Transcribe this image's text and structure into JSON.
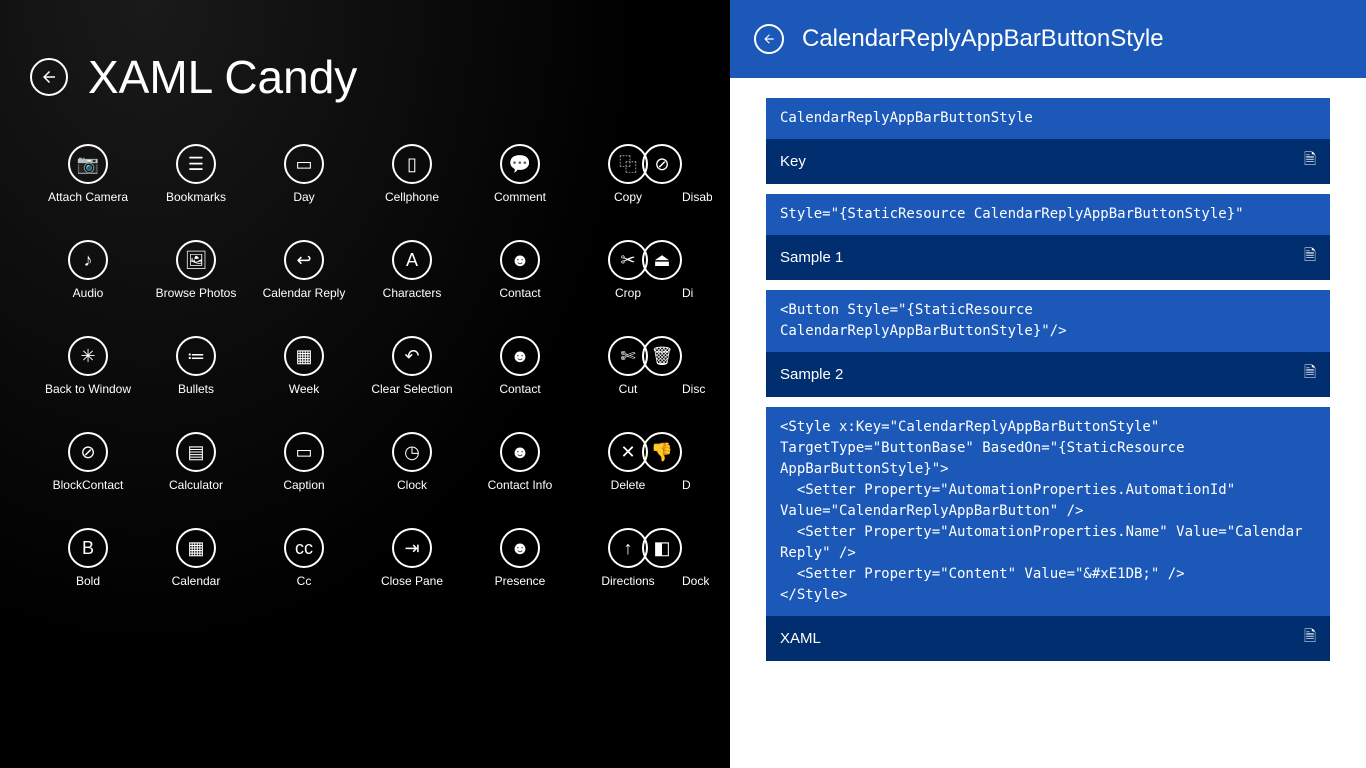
{
  "app_title": "XAML Candy",
  "colors": {
    "accent": "#1b58b8",
    "dark_accent": "#002e6e"
  },
  "icons": [
    {
      "label": "Attach Camera",
      "glyph": "📷"
    },
    {
      "label": "Bookmarks",
      "glyph": "☰"
    },
    {
      "label": "Day",
      "glyph": "▭"
    },
    {
      "label": "Cellphone",
      "glyph": "▯"
    },
    {
      "label": "Comment",
      "glyph": "💬"
    },
    {
      "label": "Copy",
      "glyph": "⿻"
    },
    {
      "label": "DisableUpdates",
      "glyph": "⊘",
      "cut": "Disabl"
    },
    {
      "label": "Audio",
      "glyph": "♪"
    },
    {
      "label": "Browse Photos",
      "glyph": "🖼"
    },
    {
      "label": "Calendar Reply",
      "glyph": "↩"
    },
    {
      "label": "Characters",
      "glyph": "A"
    },
    {
      "label": "Contact",
      "glyph": "☻"
    },
    {
      "label": "Crop",
      "glyph": "✂"
    },
    {
      "label": "Disconnect Drive",
      "glyph": "⏏",
      "cut": "Di"
    },
    {
      "label": "Back to Window",
      "glyph": "✳"
    },
    {
      "label": "Bullets",
      "glyph": "≔"
    },
    {
      "label": "Week",
      "glyph": "▦"
    },
    {
      "label": "Clear Selection",
      "glyph": "↶"
    },
    {
      "label": "Contact",
      "glyph": "☻"
    },
    {
      "label": "Cut",
      "glyph": "✄"
    },
    {
      "label": "Discard",
      "glyph": "🗑",
      "cut": "Disc"
    },
    {
      "label": "BlockContact",
      "glyph": "⊘"
    },
    {
      "label": "Calculator",
      "glyph": "▤"
    },
    {
      "label": "Caption",
      "glyph": "▭"
    },
    {
      "label": "Clock",
      "glyph": "◷"
    },
    {
      "label": "Contact Info",
      "glyph": "☻"
    },
    {
      "label": "Delete",
      "glyph": "✕"
    },
    {
      "label": "Dislike",
      "glyph": "👎",
      "cut": "D"
    },
    {
      "label": "Bold",
      "glyph": "B"
    },
    {
      "label": "Calendar",
      "glyph": "▦"
    },
    {
      "label": "Cc",
      "glyph": "cc"
    },
    {
      "label": "Close Pane",
      "glyph": "⇥"
    },
    {
      "label": "Presence",
      "glyph": "☻"
    },
    {
      "label": "Directions",
      "glyph": "↑"
    },
    {
      "label": "DockLeft",
      "glyph": "◧",
      "cut": "Dock"
    }
  ],
  "detail": {
    "title": "CalendarReplyAppBarButtonStyle",
    "sections": [
      {
        "code": "CalendarReplyAppBarButtonStyle",
        "label": "Key"
      },
      {
        "code": "Style=\"{StaticResource CalendarReplyAppBarButtonStyle}\"",
        "label": "Sample 1"
      },
      {
        "code": "<Button Style=\"{StaticResource CalendarReplyAppBarButtonStyle}\"/>",
        "label": "Sample 2"
      },
      {
        "code": "<Style x:Key=\"CalendarReplyAppBarButtonStyle\" TargetType=\"ButtonBase\" BasedOn=\"{StaticResource AppBarButtonStyle}\">\n  <Setter Property=\"AutomationProperties.AutomationId\" Value=\"CalendarReplyAppBarButton\" />\n  <Setter Property=\"AutomationProperties.Name\" Value=\"Calendar Reply\" />\n  <Setter Property=\"Content\" Value=\"&#xE1DB;\" />\n</Style>",
        "label": "XAML"
      }
    ],
    "copy_glyph": "🗎"
  }
}
